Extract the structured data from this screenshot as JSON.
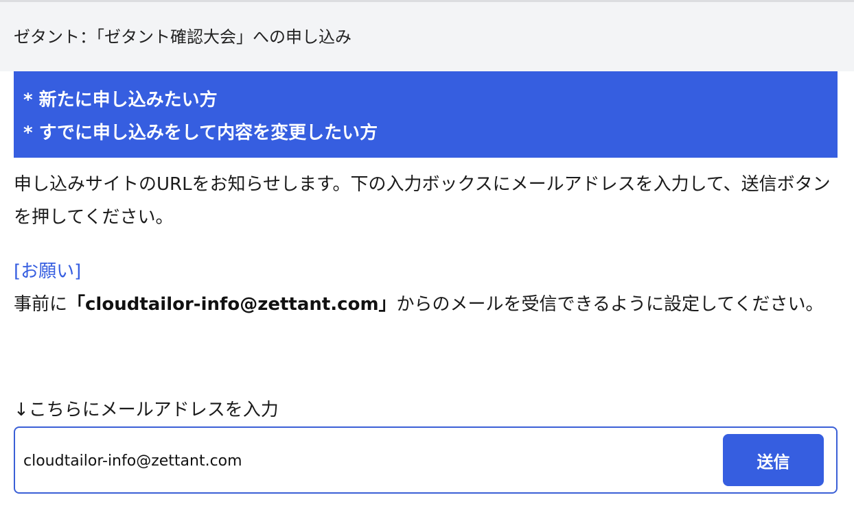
{
  "header": {
    "title": "ゼタント：「ゼタント確認大会」への申し込み"
  },
  "banner": {
    "line1": "* 新たに申し込みたい方",
    "line2": "* すでに申し込みをして内容を変更したい方"
  },
  "intro": {
    "text": "申し込みサイトのURLをお知らせします。下の入力ボックスにメールアドレスを入力して、送信ボタンを押してください。"
  },
  "request": {
    "label": "[お願い]",
    "prefix": "事前に",
    "email": "「cloudtailor-info@zettant.com」",
    "suffix": "からのメールを受信できるように設定してください。"
  },
  "form": {
    "label": "↓こちらにメールアドレスを入力",
    "email_value": "cloudtailor-info@zettant.com",
    "submit_label": "送信"
  },
  "colors": {
    "accent": "#365ee0",
    "header_bg": "#f3f4f6"
  }
}
